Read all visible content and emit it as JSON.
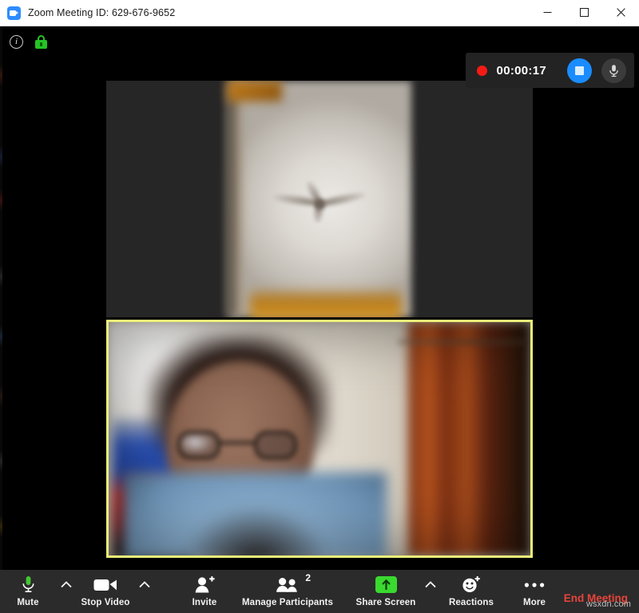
{
  "window": {
    "title": "Zoom Meeting ID: 629-676-9652",
    "logo_icon": "zoom-logo-icon",
    "controls": {
      "minimize": "minimize-icon",
      "maximize": "maximize-icon",
      "close": "close-icon"
    }
  },
  "status": {
    "info_icon": "info-icon",
    "info_glyph": "i",
    "encryption_icon": "green-padlock-icon"
  },
  "recording": {
    "indicator_icon": "record-dot-icon",
    "elapsed": "00:00:17",
    "stop_icon": "stop-recording-icon",
    "mic_icon": "microphone-icon"
  },
  "videos": [
    {
      "position": "top",
      "name_label": "",
      "active_speaker": false,
      "description": "pillarboxed view of a ceiling fan against a white wall"
    },
    {
      "position": "bottom",
      "name_label": "",
      "active_speaker": true,
      "border_color": "#e9f07a",
      "description": "participant wearing glasses and a light blue top"
    }
  ],
  "toolbar": {
    "mute": {
      "label": "Mute",
      "icon": "microphone-icon",
      "has_caret": true
    },
    "video": {
      "label": "Stop Video",
      "icon": "camera-icon",
      "has_caret": true
    },
    "invite": {
      "label": "Invite",
      "icon": "add-person-icon",
      "has_caret": false
    },
    "participants": {
      "label": "Manage Participants",
      "icon": "people-icon",
      "count": "2",
      "has_caret": false
    },
    "share": {
      "label": "Share Screen",
      "icon": "share-arrow-icon",
      "has_caret": true
    },
    "reactions": {
      "label": "Reactions",
      "icon": "smiley-plus-icon",
      "has_caret": false
    },
    "more": {
      "label": "More",
      "icon": "ellipsis-icon",
      "has_caret": false
    },
    "end": {
      "label": "End Meeting"
    }
  },
  "watermark": {
    "text": "wsxdn.com"
  },
  "colors": {
    "accent_blue": "#1a8cff",
    "record_red": "#f51b15",
    "end_red": "#e8443a",
    "share_green": "#3ad92f",
    "mic_green": "#43c832",
    "active_border": "#e9f07a",
    "toolbar_bg": "#2b2b2b"
  }
}
